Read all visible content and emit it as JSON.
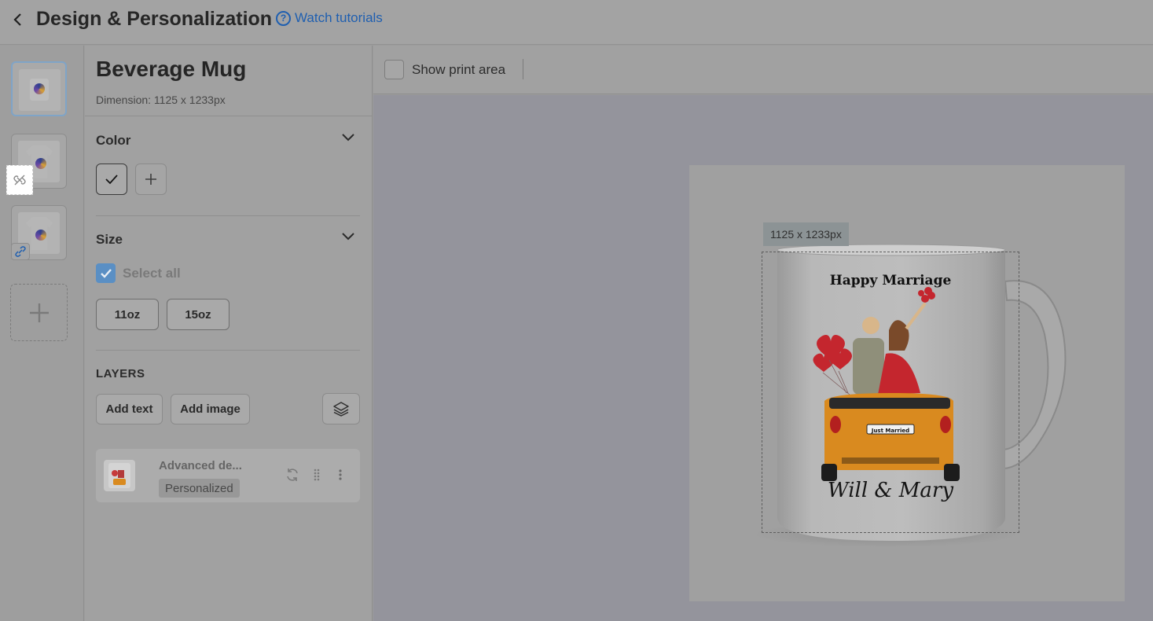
{
  "header": {
    "title": "Design & Personalization",
    "tutorial_label": "Watch tutorials",
    "help_glyph": "?"
  },
  "thumbnails": [
    {
      "kind": "mug",
      "active": true
    },
    {
      "kind": "tshirt",
      "badge": "unlink-icon"
    },
    {
      "kind": "tshirt",
      "badge": "link-icon"
    }
  ],
  "product": {
    "name": "Beverage Mug",
    "dimension": "Dimension: 1125 x 1233px"
  },
  "color": {
    "title": "Color"
  },
  "size": {
    "title": "Size",
    "select_all": "Select all",
    "options": [
      "11oz",
      "15oz"
    ]
  },
  "layers": {
    "title": "LAYERS",
    "add_text": "Add text",
    "add_image": "Add image",
    "items": [
      {
        "name": "Advanced de...",
        "tag": "Personalized"
      }
    ]
  },
  "toolbar": {
    "show_print_area": "Show print area"
  },
  "canvas": {
    "dimension_label": "1125 x 1233px",
    "design_title": "Happy Marriage",
    "design_plate": "Just Married",
    "design_script": "Will & Mary"
  },
  "colors": {
    "accent_blue": "#1f5fb0",
    "checkbox_blue": "#5a8fc4",
    "car_orange": "#d98a1f",
    "dress_red": "#c4262e"
  }
}
